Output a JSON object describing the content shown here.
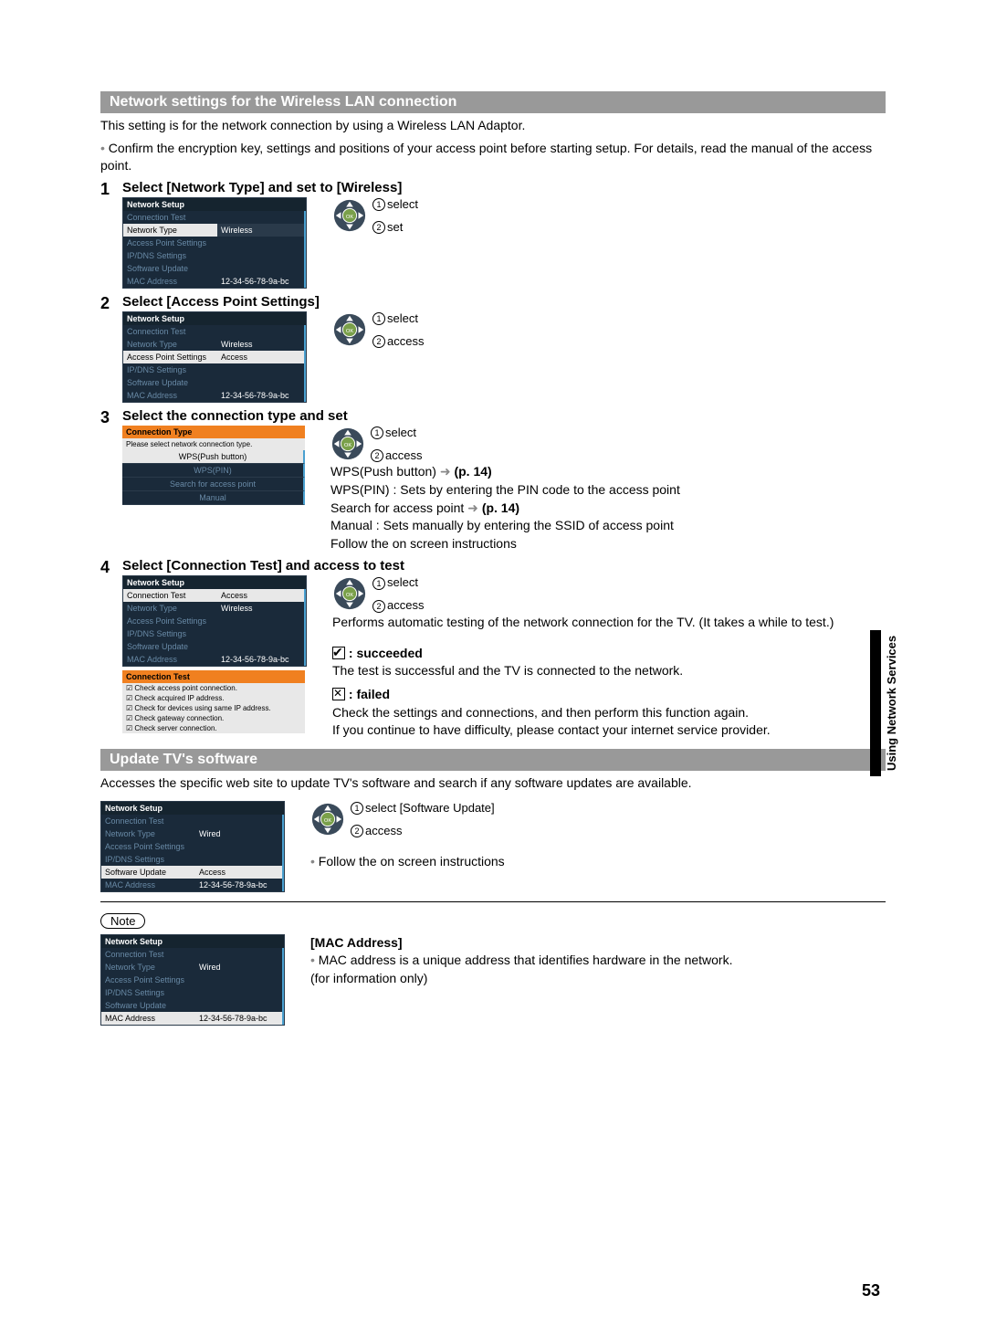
{
  "section1_title": "Network settings for the Wireless LAN connection",
  "intro_line1": "This setting is for the network connection by using a Wireless LAN Adaptor.",
  "intro_line2": "Confirm the encryption key, settings and positions of your access point before starting setup. For details, read the manual of the access point.",
  "steps": {
    "s1": {
      "num": "1",
      "title": "Select [Network Type] and set to [Wireless]"
    },
    "s2": {
      "num": "2",
      "title": "Select [Access Point Settings]"
    },
    "s3": {
      "num": "3",
      "title": "Select the connection type and set"
    },
    "s4": {
      "num": "4",
      "title": "Select [Connection Test] and access to test"
    }
  },
  "ok": {
    "select": "select",
    "set": "set",
    "access": "access"
  },
  "menu": {
    "title": "Network Setup",
    "rows": {
      "conn_test": "Connection Test",
      "net_type": "Network Type",
      "ap": "Access Point Settings",
      "ipdns": "IP/DNS Settings",
      "sw": "Software Update",
      "mac": "MAC Address"
    },
    "vals": {
      "wireless": "Wireless",
      "wired": "Wired",
      "access": "Access",
      "mac": "12-34-56-78-9a-bc"
    }
  },
  "conn_type": {
    "title": "Connection Type",
    "desc": "Please select network connection type.",
    "wps_push": "WPS(Push button)",
    "wps_pin": "WPS(PIN)",
    "search": "Search for access point",
    "manual": "Manual"
  },
  "s3_text": {
    "wps_push": "WPS(Push button)",
    "wps_push_ref": "(p. 14)",
    "wps_pin": "WPS(PIN) : Sets by entering the PIN code to the access point",
    "search": "Search for access point",
    "search_ref": "(p. 14)",
    "manual": "Manual : Sets manually by entering the SSID of access point",
    "follow": "Follow the on screen instructions"
  },
  "s4_text": {
    "performs": "Performs automatic testing of the network connection for the TV. (It takes a while to test.)",
    "succeeded": ": succeeded",
    "succeeded_desc": "The test is successful and the TV is connected to the network.",
    "failed": ": failed",
    "failed_desc1": "Check the settings and connections, and then perform this function again.",
    "failed_desc2": "If you continue to have difficulty, please contact your internet service provider."
  },
  "conn_test": {
    "title": "Connection Test",
    "c1": "Check access point connection.",
    "c2": "Check acquired IP address.",
    "c3": "Check for devices using same IP address.",
    "c4": "Check gateway connection.",
    "c5": "Check server connection."
  },
  "section2_title": "Update TV's software",
  "update_intro": "Accesses the specific web site to update TV's software and search if any software updates are available.",
  "update_sel": "select [Software Update]",
  "update_follow": "Follow the on screen instructions",
  "note_label": "Note",
  "mac_title": "[MAC Address]",
  "mac_desc": "MAC address is a unique address that identifies hardware in the network.",
  "mac_info": "(for information only)",
  "side_tab": "Using Network Services",
  "page_num": "53"
}
